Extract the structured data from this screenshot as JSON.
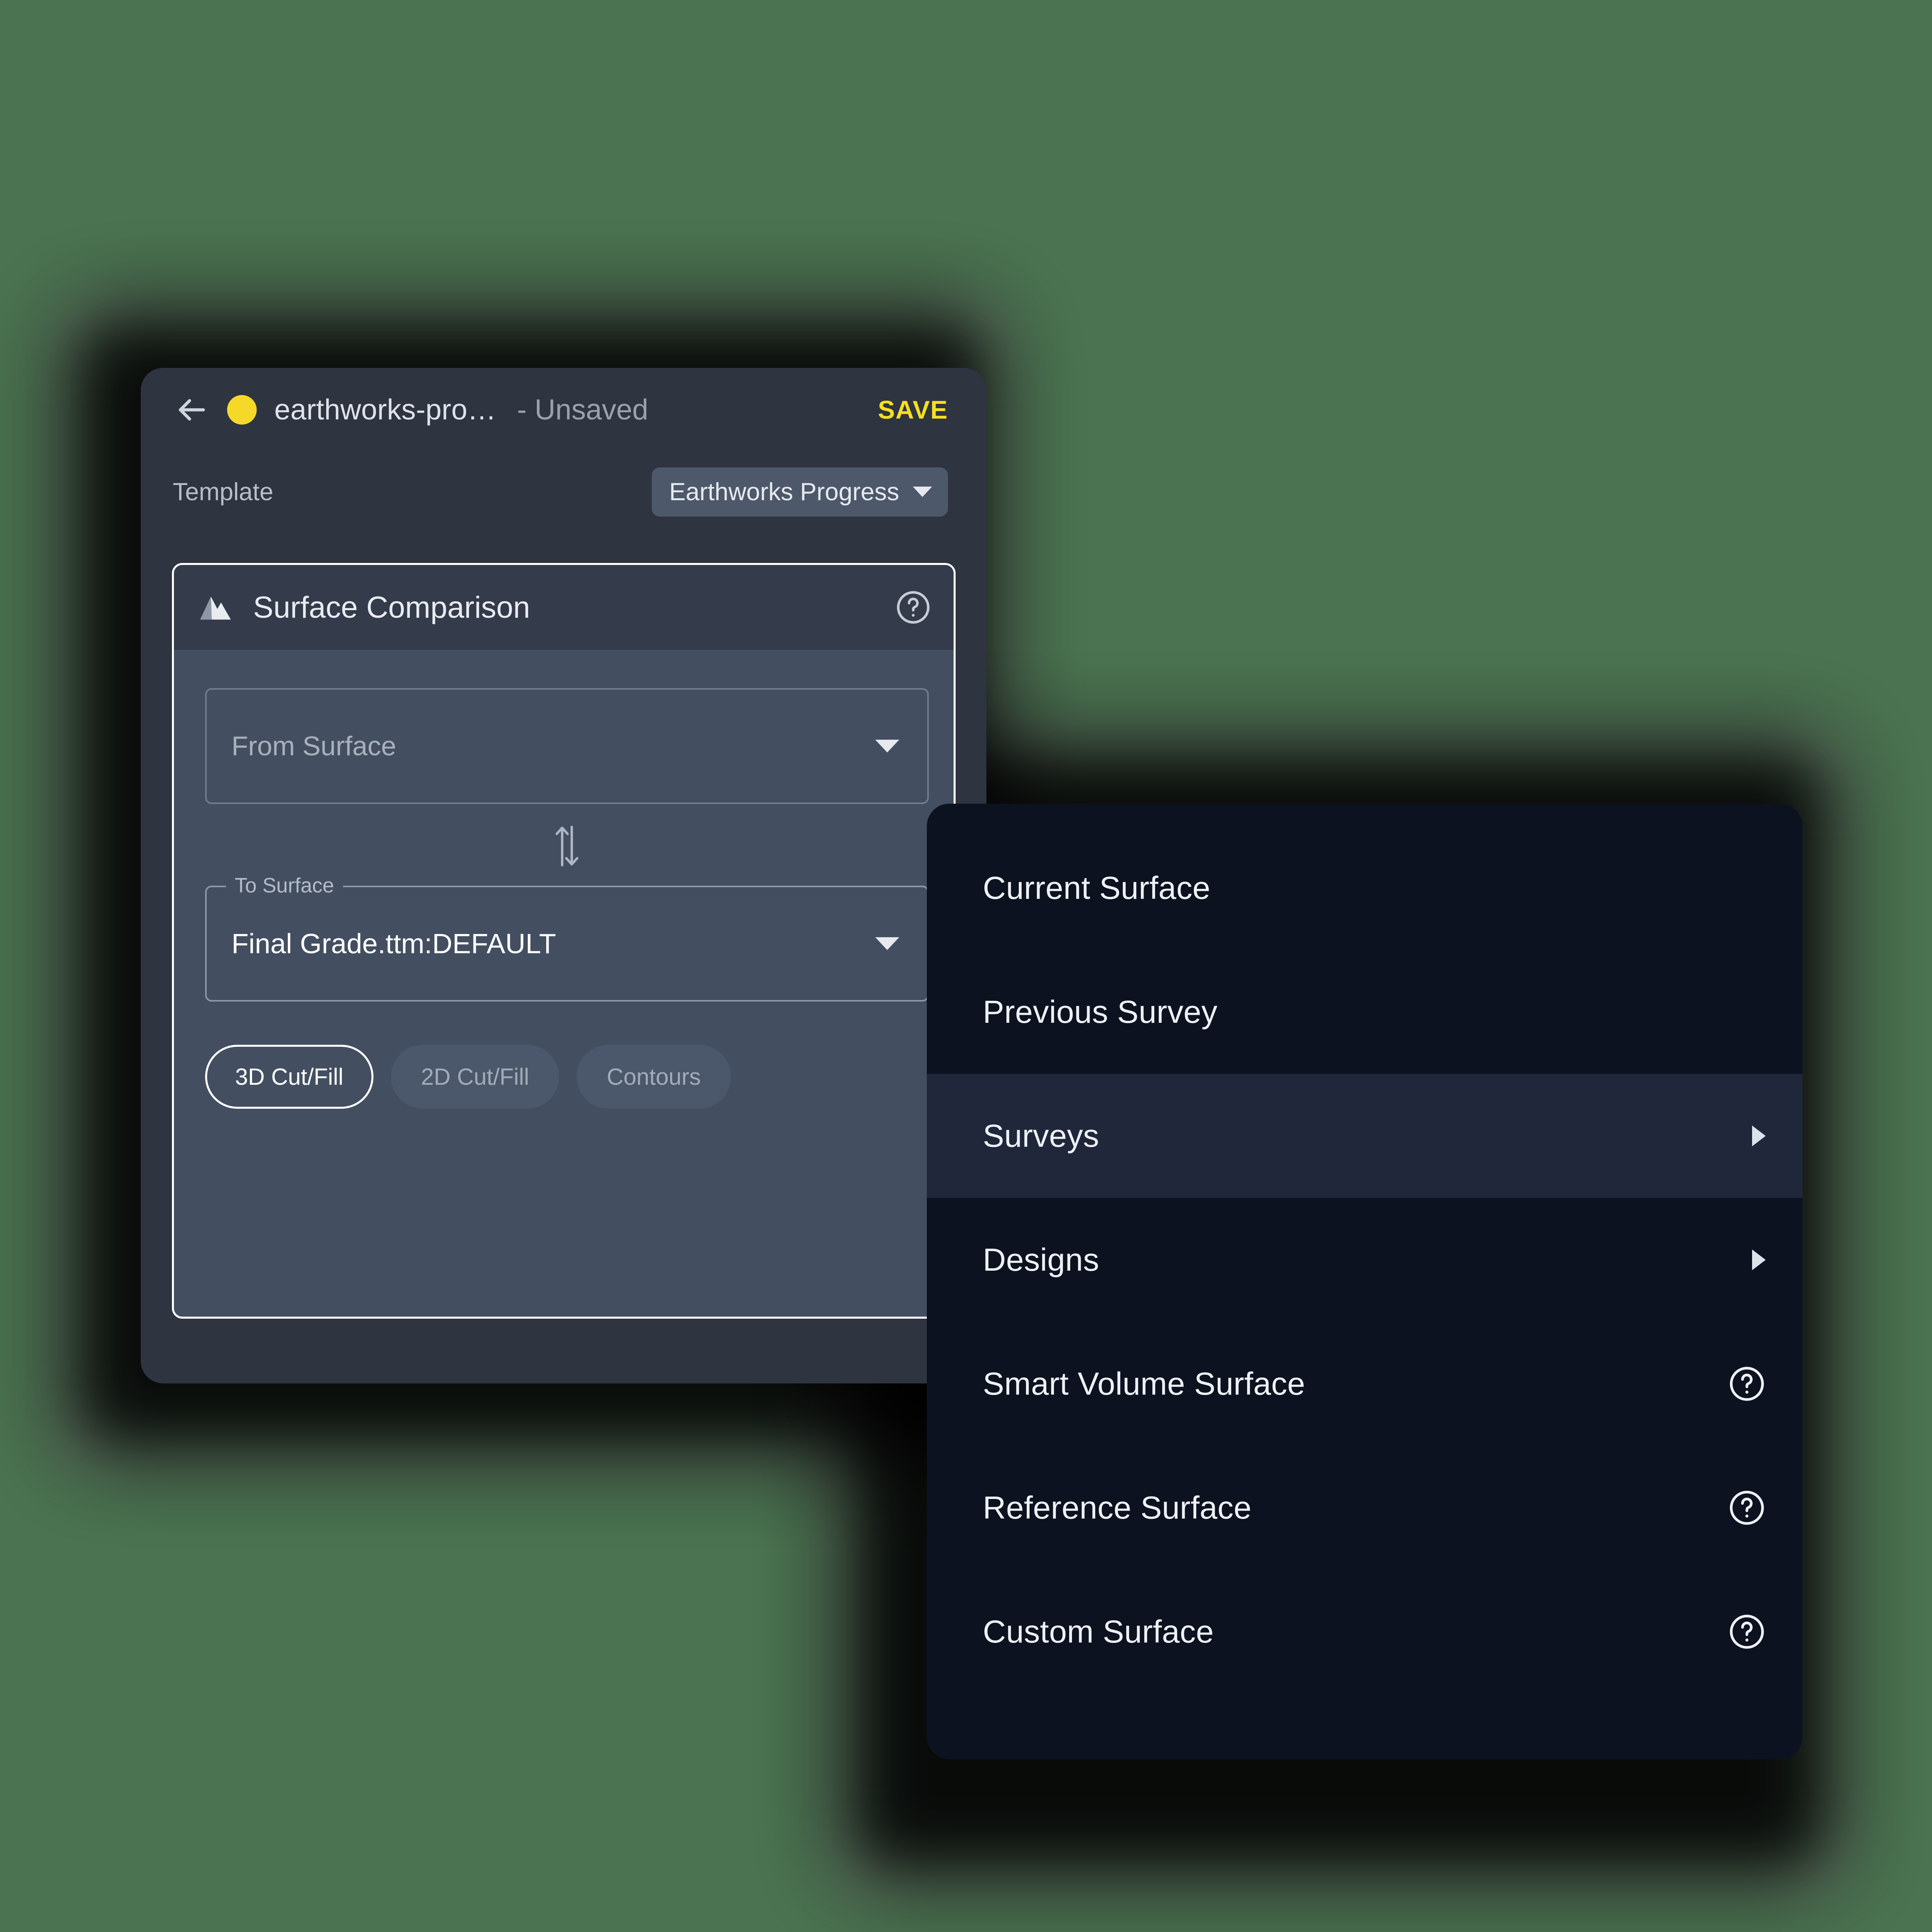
{
  "window": {
    "back_icon": "arrow-left-icon",
    "status_dot_color": "#F5D928",
    "doc_title": "earthworks-pro…",
    "doc_status": "- Unsaved",
    "save_label": "SAVE",
    "save_color": "#F5DF20"
  },
  "template": {
    "label": "Template",
    "selected": "Earthworks Progress",
    "caret_icon": "chevron-down-icon"
  },
  "card": {
    "icon": "mountain-icon",
    "title": "Surface Comparison",
    "help_icon": "help-circle-icon",
    "from_field": {
      "placeholder": "From Surface",
      "value": "",
      "caret_icon": "chevron-down-icon"
    },
    "swap_icon": "swap-vertical-icon",
    "to_field": {
      "label": "To Surface",
      "value": "Final Grade.ttm:DEFAULT",
      "caret_icon": "chevron-down-icon"
    },
    "chips": [
      {
        "label": "3D Cut/Fill",
        "selected": true
      },
      {
        "label": "2D Cut/Fill",
        "selected": false
      },
      {
        "label": "Contours",
        "selected": false
      }
    ]
  },
  "menu": {
    "items": [
      {
        "label": "Current Surface",
        "trailing": "none",
        "highlight": false
      },
      {
        "label": "Previous Survey",
        "trailing": "none",
        "highlight": false
      },
      {
        "label": "Surveys",
        "trailing": "submenu",
        "highlight": true
      },
      {
        "label": "Designs",
        "trailing": "submenu",
        "highlight": false
      },
      {
        "label": "Smart Volume Surface",
        "trailing": "help",
        "highlight": false
      },
      {
        "label": "Reference Surface",
        "trailing": "help",
        "highlight": false
      },
      {
        "label": "Custom Surface",
        "trailing": "help",
        "highlight": false
      }
    ]
  },
  "colors": {
    "page_background": "#4b7351",
    "panel_background": "#2e3440",
    "card_background": "#434f61",
    "card_header": "#343b4a",
    "menu_background": "#0d1220",
    "menu_highlight": "#20273a",
    "accent_yellow": "#F5DF20"
  }
}
